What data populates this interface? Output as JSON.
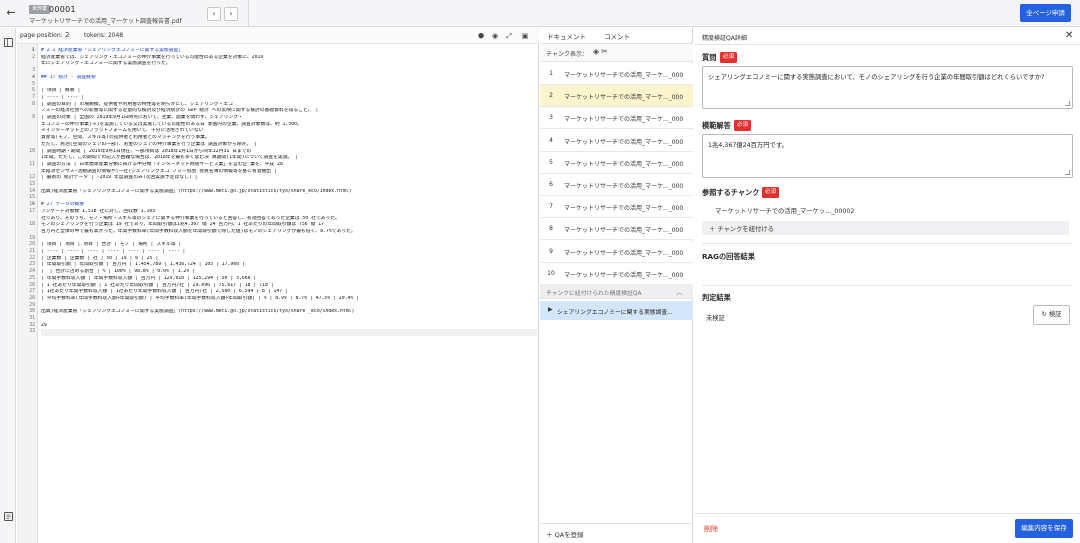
{
  "header": {
    "status_badge": "未作業",
    "doc_id": "00001",
    "file_name": "マーケットリサーチでの活用_マーケット調査報告書.pdf",
    "prev_icon": "‹",
    "next_icon": "›",
    "apply_all_label": "全ページ申請"
  },
  "editor": {
    "page_position_label": "page position:",
    "page_position_value": "2",
    "tokens_label": "tokens: 2048",
    "lines": [
      {
        "n": "1",
        "fold": "▾",
        "text": "# 2.1 経済産業省「シェアリングエコノミーに関する実態調査」",
        "heading": true
      },
      {
        "n": "2",
        "fold": "",
        "text": "経済産業省では、シェアリング・エコノミーの仲介事業を行っている可能性のある企業を対象に、2019"
      },
      {
        "n": "",
        "fold": "",
        "text": "年にシェアリング・エコノミーに関する実態調査を行った。"
      },
      {
        "n": "3",
        "fold": "",
        "text": ""
      },
      {
        "n": "4",
        "fold": "▾",
        "text": "## 1) 統計 - 調査概要",
        "heading": true
      },
      {
        "n": "5",
        "fold": "",
        "text": ""
      },
      {
        "n": "6",
        "fold": "",
        "text": "| 項目 | 概要 |"
      },
      {
        "n": "7",
        "fold": "",
        "text": "| ---- | ---- |"
      },
      {
        "n": "8",
        "fold": "",
        "text": "| 調査の目的 | 市場規模、提供者や利用者の特性等を明らかにし、シェアリング・エコ"
      },
      {
        "n": "",
        "fold": "",
        "text": "ノミーの経済社会への影響等に関する定量的な検討及び経済統計の GDP 統計 への反映に関する検討の基礎資料を得ること。 |"
      },
      {
        "n": "9",
        "fold": "",
        "text": "| 調査の対象 | 全国の 2019年9月1日時点において、主業、副業を問わず、シェアリング・"
      },
      {
        "n": "",
        "fold": "",
        "text": "エコノミーの仲介事業(※)を実施している又は実施している可能性のある日 本国内の企業。調査対象数は、約 1,500。"
      },
      {
        "n": "",
        "fold": "",
        "text": "※インターネット上のプラットフォームを用いて、十分に活用されていない"
      },
      {
        "n": "",
        "fold": "",
        "text": "資産等(モノ、空間、スキル等)の提供者と利用者とのマッチングを行う事業。"
      },
      {
        "n": "",
        "fold": "",
        "text": "ただし、民泊(空間のシェアの一部)、お金のシェアの仲介事業を行う企業は 調査対象から除外。 |"
      },
      {
        "n": "10",
        "fold": "",
        "text": "| 調査時期・期間 | 2019年9月1日現在、一部項目は 2018年1月1日から同年12月31 日までの"
      },
      {
        "n": "",
        "fold": "",
        "text": "1年間。ただし、この期間での記入が困難な場合は、2018年を最も多く含む決 算期間(1年間)について調査を実施。 |"
      },
      {
        "n": "11",
        "fold": "",
        "text": "| 調査の方法 | 日本標準産業分類に掲げる中分類「インターネット附随サービス業」を営む企 業を、平成 28"
      },
      {
        "n": "",
        "fold": "",
        "text": "年経済センサス―活動調査の情報や(一社)シェアリングエコ ノミー協会 会員名簿の情報等を基に有意抽出 |"
      },
      {
        "n": "12",
        "fold": "",
        "text": "| 最新の 統計データ | -2019 年度調査のみ(次回実施予定はなし) |"
      },
      {
        "n": "13",
        "fold": "",
        "text": ""
      },
      {
        "n": "14",
        "fold": "",
        "text": "出典)経済産業省「シェアリングエコノミーに関する実態調査」(https://www.meti.go.jp/statistics/tyo/share_eco/index.html)"
      },
      {
        "n": "15",
        "fold": "",
        "text": ""
      },
      {
        "n": "16",
        "fold": "▾",
        "text": "# 2) データの概要",
        "heading": true
      },
      {
        "n": "17",
        "fold": "",
        "text": "アンケート対象数 1,518 社に対し、回収数 1,103"
      },
      {
        "n": "",
        "fold": "",
        "text": "社であり、そのうち、モノ・場所・スキル等のシェアに関する仲介事業を行っていると回答し、有効回答であった企業は 50 社であった。"
      },
      {
        "n": "18",
        "fold": "",
        "text": "モノのシェアリングを行う企業は 19 社であり、年間取引額は1兆4,367 億 24 百万円、1 社あたりの年間取引額は 756 億 17"
      },
      {
        "n": "",
        "fold": "",
        "text": "百万円と全体の中で最も高かった。年間手数料率(年間手数料収入額を年間取引額で除した値)はモノのシェアリングが最も低く、8.7%であった。"
      },
      {
        "n": "19",
        "fold": "",
        "text": ""
      },
      {
        "n": "20",
        "fold": "",
        "text": "| 項目 | 項目 | 項目 | 合計 | モノ | 場所 | スキル等 |"
      },
      {
        "n": "21",
        "fold": "",
        "text": "| ---- | ---- | ---- | ---- | ---- | ---- | ---- |"
      },
      {
        "n": "22",
        "fold": "",
        "text": "| 企業数 | 企業数 | 社 | 50 | 19 | 6 | 25 |"
      },
      {
        "n": "23",
        "fold": "",
        "text": "| 年間取引額 | 年間取引額 | 百万円 | 1,454,789 | 1,436,724 | 105 | 17,960 |"
      },
      {
        "n": "24",
        "fold": "",
        "text": "|  | 合計に占める割合 | % | 100% | 98.8% | 0.0% | 1.2% |"
      },
      {
        "n": "25",
        "fold": "",
        "text": "| 年間手数料収入額 | 年間手数料収入額 | 百万円 | 129,010 | 125,294 | 50 | 3,666 |"
      },
      {
        "n": "26",
        "fold": "",
        "text": "| 1 社あたり年間取引額 | 1 社あたり年間取引額 | 百万円/社 | 29,096 | 75,617 | 18 | 718 |"
      },
      {
        "n": "27",
        "fold": "",
        "text": "| 1社あたり年間手数料収入額 | 1社あたり年間手数料収入額 | 百万円/社 | 2,580 | 6,594 | 8 | 147 |"
      },
      {
        "n": "28",
        "fold": "",
        "text": "| 平均手数料率(年間手数料収入額÷年間取引額) | 平均手数料率(年間手数料収入額÷年間取引額) | % | 8.9% | 8.7% | 47.5% | 20.4% |"
      },
      {
        "n": "29",
        "fold": "",
        "text": ""
      },
      {
        "n": "30",
        "fold": "",
        "text": "出典)経済産業省「シェアリングエコノミーに関する実態調査」(https://www.meti.go.jp/statistics/tyo/share _eco/index.html)"
      },
      {
        "n": "31",
        "fold": "",
        "text": ""
      },
      {
        "n": "32",
        "fold": "",
        "text": "29"
      },
      {
        "n": "33",
        "fold": "",
        "text": "",
        "active": true
      }
    ]
  },
  "middle": {
    "tab_document": "ドキュメント",
    "tab_comment": "コメント",
    "chunk_display_label": "チャンク表示：",
    "chunks": [
      {
        "num": "1",
        "title": "マーケットリサーチでの活用_マーケ..._000"
      },
      {
        "num": "2",
        "title": "マーケットリサーチでの活用_マーケ..._000",
        "selected": true
      },
      {
        "num": "3",
        "title": "マーケットリサーチでの活用_マーケ..._000"
      },
      {
        "num": "4",
        "title": "マーケットリサーチでの活用_マーケ..._000"
      },
      {
        "num": "5",
        "title": "マーケットリサーチでの活用_マーケ..._000"
      },
      {
        "num": "6",
        "title": "マーケットリサーチでの活用_マーケ..._000"
      },
      {
        "num": "7",
        "title": "マーケットリサーチでの活用_マーケ..._000"
      },
      {
        "num": "8",
        "title": "マーケットリサーチでの活用_マーケ..._000"
      },
      {
        "num": "9",
        "title": "マーケットリサーチでの活用_マーケ..._000"
      },
      {
        "num": "10",
        "title": "マーケットリサーチでの活用_マーケ..._000"
      }
    ],
    "qa_section_title": "チャンクに紐付けられた精度検証QA",
    "qa_item": "シェアリングエコノミーに関する実態調査...",
    "register_qa": "QAを登録"
  },
  "detail": {
    "title": "精度検証QA詳細",
    "question_label": "質問",
    "required_badge": "必須",
    "question_value": "シェアリングエコノミーに関する実態調査において、モノのシェアリングを行う企業の年間取引額はどれくらいですか?",
    "model_answer_label": "模範解答",
    "model_answer_value": "1兆4,367億24百万円です。",
    "ref_chunk_label": "参照するチャンク",
    "ref_chunk_value": "マーケットリサーチでの活用_マーケッ..._00002",
    "link_chunk_label": "チャンクを紐付ける",
    "rag_label": "RAGの回答結果",
    "judge_label": "判定結果",
    "judge_value": "未検証",
    "verify_label": "検証",
    "delete_label": "削除",
    "save_label": "編集内容を保存"
  }
}
